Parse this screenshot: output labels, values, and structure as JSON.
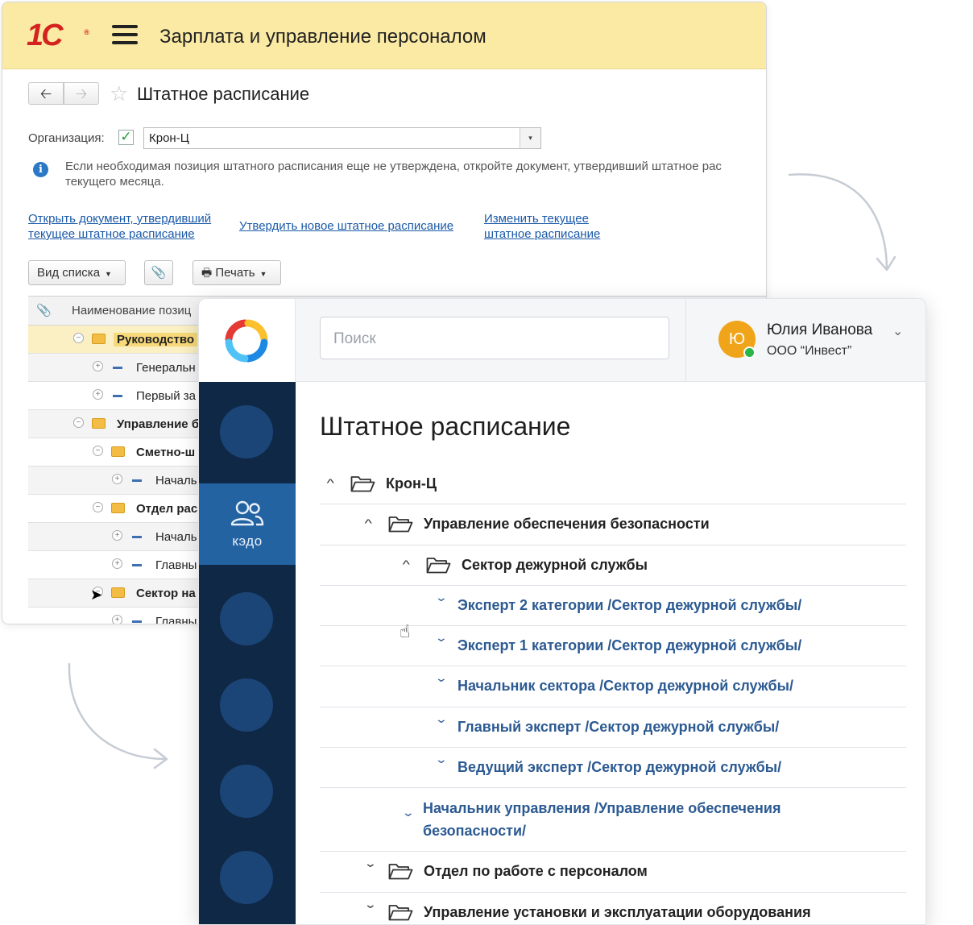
{
  "onec": {
    "logo": "1С",
    "app_title": "Зарплата и управление персоналом",
    "form_title": "Штатное расписание",
    "org_label": "Организация:",
    "org_value": "Крон-Ц",
    "info_text_line1": "Если необходимая позиция штатного расписания еще не утверждена, откройте документ, утвердивший штатное рас",
    "info_text_line2": "текущего месяца.",
    "links": [
      "Открыть документ, утвердивший текущее штатное расписание",
      "Утвердить новое штатное расписание",
      "Изменить текущее штатное расписание"
    ],
    "toolbar": {
      "view_list": "Вид списка",
      "print": "Печать"
    },
    "grid_header": "Наименование позиц",
    "grid_rows": [
      {
        "text": "Руководство",
        "kind": "group",
        "level": 1,
        "bold": true,
        "selected": true
      },
      {
        "text": "Генеральн",
        "kind": "item",
        "level": 2
      },
      {
        "text": "Первый за",
        "kind": "item",
        "level": 2
      },
      {
        "text": "Управление б",
        "kind": "group",
        "level": 1,
        "bold": true
      },
      {
        "text": "Сметно-ш",
        "kind": "group",
        "level": 2,
        "bold": true
      },
      {
        "text": "Началь",
        "kind": "item",
        "level": 3
      },
      {
        "text": "Отдел рас",
        "kind": "group",
        "level": 2,
        "bold": true
      },
      {
        "text": "Началь",
        "kind": "item",
        "level": 3
      },
      {
        "text": "Главны",
        "kind": "item",
        "level": 3
      },
      {
        "text": "Сектор на",
        "kind": "group",
        "level": 2,
        "bold": true
      },
      {
        "text": "Главны",
        "kind": "item",
        "level": 3
      }
    ]
  },
  "kedo": {
    "search_placeholder": "Поиск",
    "user_initial": "Ю",
    "user_name": "Юлия Иванова",
    "user_org": "ООО “Инвест”",
    "nav_active_label": "кэдо",
    "page_title": "Штатное расписание",
    "tree": [
      {
        "text": "Крон-Ц",
        "kind": "folder",
        "level": 0,
        "expanded": true
      },
      {
        "text": "Управление обеспечения безопасности",
        "kind": "folder",
        "level": 1,
        "expanded": true
      },
      {
        "text": "Сектор дежурной службы",
        "kind": "folder",
        "level": 2,
        "expanded": true
      },
      {
        "text": "Эксперт 2 категории /Сектор дежурной службы/",
        "kind": "position",
        "level": 3
      },
      {
        "text": "Эксперт 1 категории /Сектор дежурной службы/",
        "kind": "position",
        "level": 3
      },
      {
        "text": "Начальник сектора /Сектор дежурной службы/",
        "kind": "position",
        "level": 3
      },
      {
        "text": "Главный эксперт /Сектор дежурной службы/",
        "kind": "position",
        "level": 3
      },
      {
        "text": "Ведущий эксперт /Сектор дежурной службы/",
        "kind": "position",
        "level": 3
      },
      {
        "text": "Начальник управления /Управление обеспечения безопасности/",
        "kind": "position",
        "level": 2
      },
      {
        "text": "Отдел по работе с персоналом",
        "kind": "folder",
        "level": 1,
        "expanded": false
      },
      {
        "text": "Управление установки и эксплуатации оборудования",
        "kind": "folder",
        "level": 1,
        "expanded": false
      }
    ]
  },
  "colors": {
    "onec_header": "#fbeaa4",
    "onec_logo": "#d4231f",
    "kedo_sidebar": "#0e2846",
    "kedo_active": "#2463a2",
    "kedo_link": "#2c5a92",
    "avatar": "#f0a419",
    "online": "#2bb64a"
  }
}
